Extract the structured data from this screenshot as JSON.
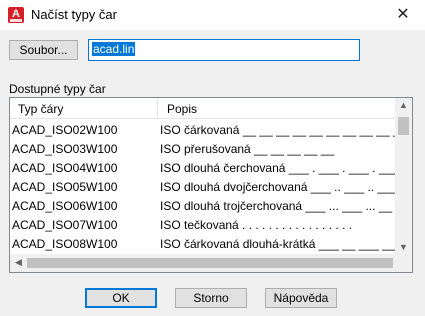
{
  "window": {
    "title": "Načíst typy čar",
    "close_glyph": "✕",
    "icon_letter": "A"
  },
  "file": {
    "button_label": "Soubor...",
    "value": "acad.lin"
  },
  "available_label": "Dostupné typy čar",
  "list": {
    "columns": [
      "Typ čáry",
      "Popis"
    ],
    "rows": [
      {
        "name": "ACAD_ISO02W100",
        "desc": "ISO čárkovaná __ __ __ __ __ __ __ __ __ __"
      },
      {
        "name": "ACAD_ISO03W100",
        "desc": "ISO přerušovaná __    __    __    __    __"
      },
      {
        "name": "ACAD_ISO04W100",
        "desc": "ISO dlouhá čerchovaná ___ . ___ . ___ . ___"
      },
      {
        "name": "ACAD_ISO05W100",
        "desc": "ISO dlouhá dvojčerchovaná ___ .. ___ .. ___"
      },
      {
        "name": "ACAD_ISO06W100",
        "desc": "ISO dlouhá trojčerchovaná ___ ... ___ ... __"
      },
      {
        "name": "ACAD_ISO07W100",
        "desc": "ISO tečkovaná . . . . . . . . . . . . . . . . ."
      },
      {
        "name": "ACAD_ISO08W100",
        "desc": "ISO čárkovaná dlouhá-krátká ___ __ ___ __ ___"
      }
    ],
    "scroll_up": "▲",
    "scroll_down": "▼",
    "scroll_left": "◀",
    "scroll_right": "▶"
  },
  "buttons": {
    "ok": "OK",
    "cancel": "Storno",
    "help": "Nápověda"
  },
  "colors": {
    "accent": "#0078d7",
    "icon_red": "#d61f26"
  }
}
